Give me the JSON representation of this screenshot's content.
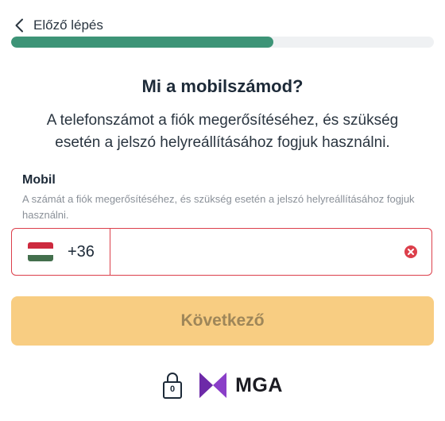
{
  "nav": {
    "back_label": "Előző lépés"
  },
  "progress": {
    "fraction": 0.62
  },
  "header": {
    "title": "Mi a mobilszámod?",
    "subtitle": "A telefonszámot a fiók megerősítéséhez, és szükség esetén a jelszó helyreállításához fogjuk használni."
  },
  "phone_field": {
    "label": "Mobil",
    "help_text": "A számát a fiók megerősítéséhez, és szükség esetén a jelszó helyreállításához fogjuk használni.",
    "country_flag": "hungary-flag",
    "dial_code": "+36",
    "value": "",
    "placeholder": ""
  },
  "actions": {
    "next_label": "Következő"
  },
  "footer": {
    "age_limit": "0",
    "logo_text": "MGA"
  },
  "colors": {
    "progress_fill": "#3d9477",
    "error_border": "#dc3f4b",
    "button_disabled_bg": "#f8cd82",
    "button_disabled_text": "#9e8659",
    "mga_purple": "#8a3ec8"
  },
  "icons": {
    "back": "chevron-left-icon",
    "clear": "clear-circle-icon",
    "lock": "lock-icon",
    "mga": "mga-logo-icon"
  }
}
